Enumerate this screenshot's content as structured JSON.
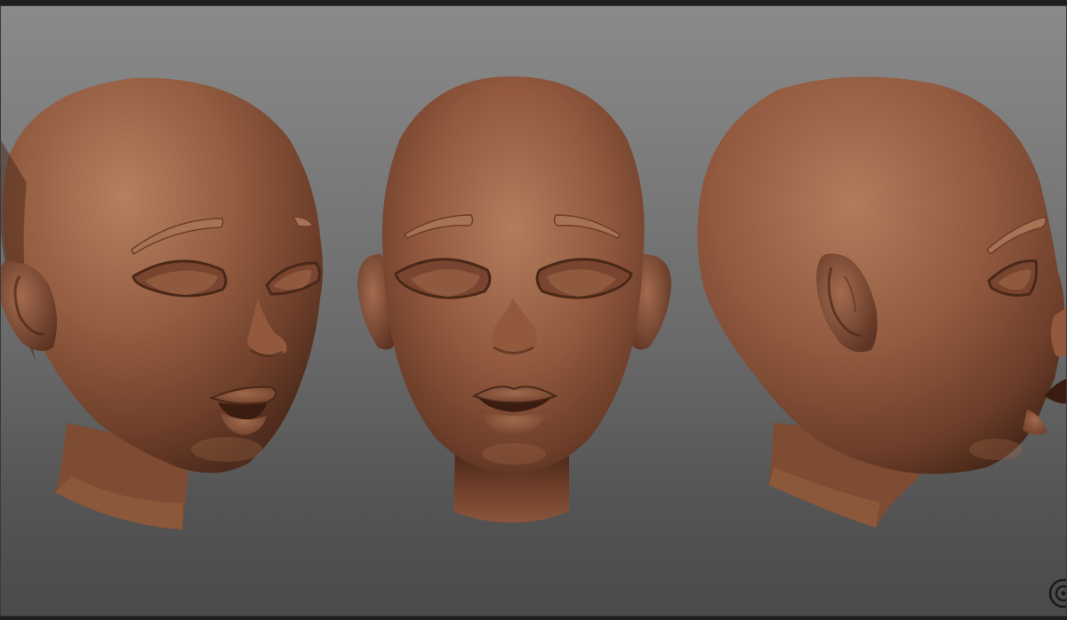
{
  "scene": {
    "background_top": "#8a8a8a",
    "background_bottom": "#4a4a4a",
    "skin_light": "#b07a5e",
    "skin_mid": "#8f5a40",
    "skin_dark": "#5e3524",
    "views": [
      {
        "name": "three-quarter-view"
      },
      {
        "name": "front-view"
      },
      {
        "name": "side-view"
      }
    ],
    "corner_icon": "gyroscope-icon"
  }
}
